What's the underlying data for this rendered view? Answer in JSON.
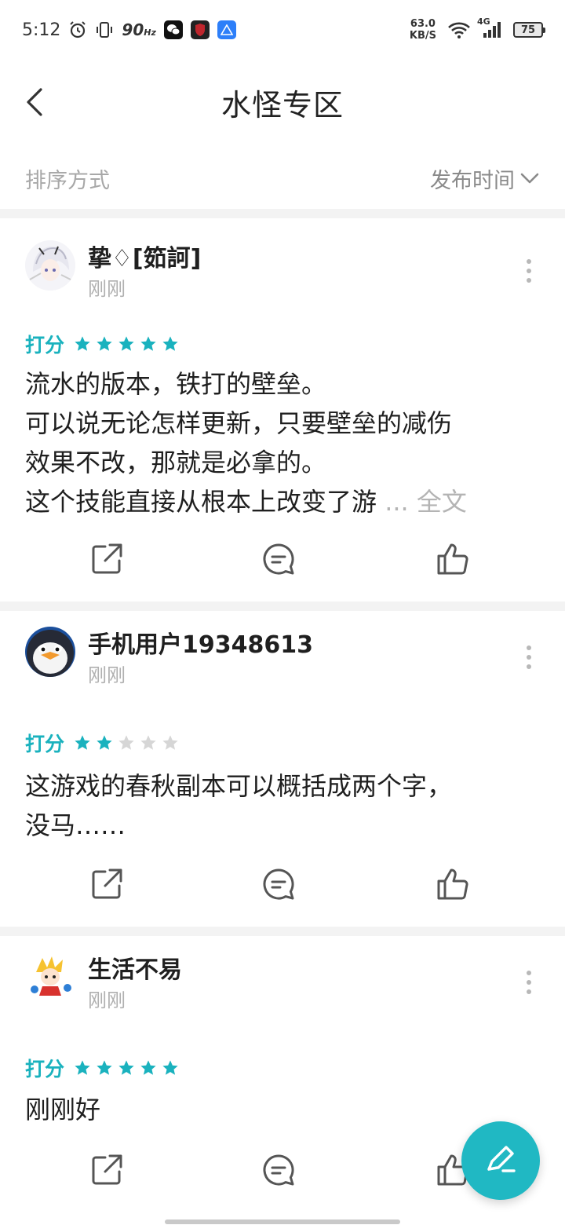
{
  "status_bar": {
    "time": "5:12",
    "refresh_rate": "90",
    "refresh_unit": "Hz",
    "net_speed_value": "63.0",
    "net_speed_unit": "KB/S",
    "network_type": "4G",
    "battery_level": "75"
  },
  "header": {
    "title": "水怪专区"
  },
  "sort": {
    "label": "排序方式",
    "selected": "发布时间"
  },
  "rating_label": "打分",
  "reviews": [
    {
      "user": "挚♢[筎訶]",
      "time": "刚刚",
      "rating": 5,
      "max_rating": 5,
      "lines": [
        "流水的版本，铁打的壁垒。",
        "可以说无论怎样更新，只要壁垒的减伤",
        "效果不改，那就是必拿的。",
        "这个技能直接从根本上改变了游"
      ],
      "expand_label": "... 全文"
    },
    {
      "user": "手机用户19348613",
      "time": "刚刚",
      "rating": 2,
      "max_rating": 5,
      "lines": [
        "这游戏的春秋副本可以概括成两个字，",
        "没马……"
      ]
    },
    {
      "user": "生活不易",
      "time": "刚刚",
      "rating": 5,
      "max_rating": 5,
      "lines": [
        "刚刚好"
      ]
    }
  ],
  "colors": {
    "accent": "#1ab2be",
    "star_filled": "#1ab2be",
    "star_empty": "#d6d6d6",
    "fab": "#20b8c3"
  },
  "icons": {
    "back": "chevron-left-icon",
    "sort_dropdown": "chevron-down-icon",
    "share": "share-icon",
    "comment": "comment-icon",
    "like": "thumbs-up-icon",
    "more": "more-vertical-icon",
    "fab": "pen-icon"
  }
}
